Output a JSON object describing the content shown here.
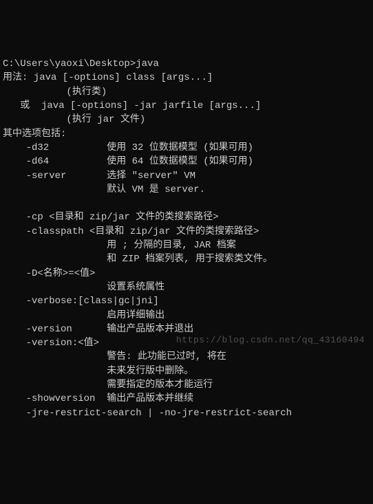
{
  "terminal": {
    "prompt": "C:\\Users\\yaoxi\\Desktop>",
    "command": "java",
    "lines": [
      "用法: java [-options] class [args...]",
      "           (执行类)",
      "   或  java [-options] -jar jarfile [args...]",
      "           (执行 jar 文件)",
      "其中选项包括:",
      "    -d32          使用 32 位数据模型 (如果可用)",
      "    -d64          使用 64 位数据模型 (如果可用)",
      "    -server       选择 \"server\" VM",
      "                  默认 VM 是 server.",
      "",
      "    -cp <目录和 zip/jar 文件的类搜索路径>",
      "    -classpath <目录和 zip/jar 文件的类搜索路径>",
      "                  用 ; 分隔的目录, JAR 档案",
      "                  和 ZIP 档案列表, 用于搜索类文件。",
      "    -D<名称>=<值>",
      "                  设置系统属性",
      "    -verbose:[class|gc|jni]",
      "                  启用详细输出",
      "    -version      输出产品版本并退出",
      "    -version:<值>",
      "                  警告: 此功能已过时, 将在",
      "                  未来发行版中删除。",
      "                  需要指定的版本才能运行",
      "    -showversion  输出产品版本并继续",
      "    -jre-restrict-search | -no-jre-restrict-search"
    ]
  },
  "watermark": "https://blog.csdn.net/qq_43160494"
}
